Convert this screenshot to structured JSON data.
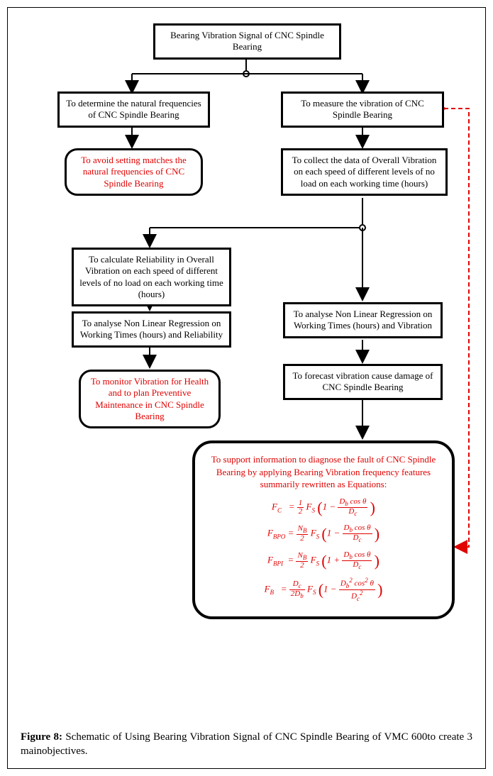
{
  "nodes": {
    "title": "Bearing Vibration Signal of CNC Spindle Bearing",
    "left1": "To determine the natural frequencies of CNC Spindle Bearing",
    "right1": "To measure the vibration of CNC Spindle Bearing",
    "left1out": "To avoid setting matches the natural frequencies of CNC Spindle Bearing",
    "right2": "To collect the data of Overall Vibration on each speed of different levels of no load on each working time (hours)",
    "left3": "To calculate Reliability in Overall Vibration on each speed of different levels of no load on each working time (hours)",
    "left4": "To analyse Non Linear Regression on Working Times (hours) and Reliability",
    "right4": "To analyse Non Linear Regression on Working Times (hours) and Vibration",
    "left4out": "To monitor Vibration for Health and to plan Preventive Maintenance in CNC Spindle Bearing",
    "right5": "To forecast vibration cause damage of CNC Spindle Bearing",
    "finalIntro": "To support information to diagnose the fault of CNC Spindle Bearing by applying Bearing Vibration frequency features summarily rewritten as Equations:"
  },
  "caption": {
    "label": "Figure 8:",
    "text": " Schematic of Using Bearing Vibration Signal of CNC Spindle Bearing of VMC 600to create 3 mainobjectives."
  },
  "chart_data": {
    "type": "flowchart",
    "title": "Schematic of Using Bearing Vibration Signal of CNC Spindle Bearing of VMC 600 to create 3 main objectives",
    "nodes": [
      {
        "id": "A",
        "label": "Bearing Vibration Signal of CNC Spindle Bearing",
        "kind": "start"
      },
      {
        "id": "B1",
        "label": "To determine the natural frequencies of CNC Spindle Bearing",
        "kind": "process"
      },
      {
        "id": "B2",
        "label": "To measure the vibration of CNC Spindle Bearing",
        "kind": "process"
      },
      {
        "id": "C1",
        "label": "To avoid setting matches the natural frequencies of CNC Spindle Bearing",
        "kind": "terminator",
        "highlight": true
      },
      {
        "id": "C2",
        "label": "To collect the data of Overall Vibration on each speed of different levels of no load on each working time (hours)",
        "kind": "process"
      },
      {
        "id": "D1",
        "label": "To calculate Reliability in Overall Vibration on each speed of different levels of no load on each working time (hours)",
        "kind": "process"
      },
      {
        "id": "D2",
        "label": "To analyse Non Linear Regression on Working Times (hours) and Vibration",
        "kind": "process"
      },
      {
        "id": "E1",
        "label": "To analyse Non Linear Regression on Working Times (hours) and Reliability",
        "kind": "process"
      },
      {
        "id": "F1",
        "label": "To monitor Vibration for Health and to plan Preventive Maintenance in CNC Spindle Bearing",
        "kind": "terminator",
        "highlight": true
      },
      {
        "id": "F2",
        "label": "To forecast vibration cause damage of CNC Spindle Bearing",
        "kind": "process"
      },
      {
        "id": "G",
        "label": "To support information to diagnose the fault of CNC Spindle Bearing by applying Bearing Vibration frequency features summarily rewritten as Equations",
        "kind": "terminator",
        "highlight": true,
        "equations": [
          "F_C = (1/2) F_S (1 - (D_b cosθ)/D_c)",
          "F_BPO = (N_B/2) F_S (1 - (D_b cosθ)/D_c)",
          "F_BPI = (N_B/2) F_S (1 + (D_b cosθ)/D_c)",
          "F_B = (D_c/(2 D_b)) F_S (1 - (D_b^2 cos^2 θ)/D_c^2)"
        ]
      }
    ],
    "edges": [
      {
        "from": "A",
        "to": "B1"
      },
      {
        "from": "A",
        "to": "B2"
      },
      {
        "from": "B1",
        "to": "C1"
      },
      {
        "from": "B2",
        "to": "C2"
      },
      {
        "from": "C2",
        "to": "D1"
      },
      {
        "from": "C2",
        "to": "D2"
      },
      {
        "from": "D1",
        "to": "E1"
      },
      {
        "from": "E1",
        "to": "F1"
      },
      {
        "from": "D2",
        "to": "F2"
      },
      {
        "from": "F2",
        "to": "G"
      },
      {
        "from": "B2",
        "to": "G",
        "style": "dashed-feedback",
        "color": "red"
      }
    ]
  }
}
